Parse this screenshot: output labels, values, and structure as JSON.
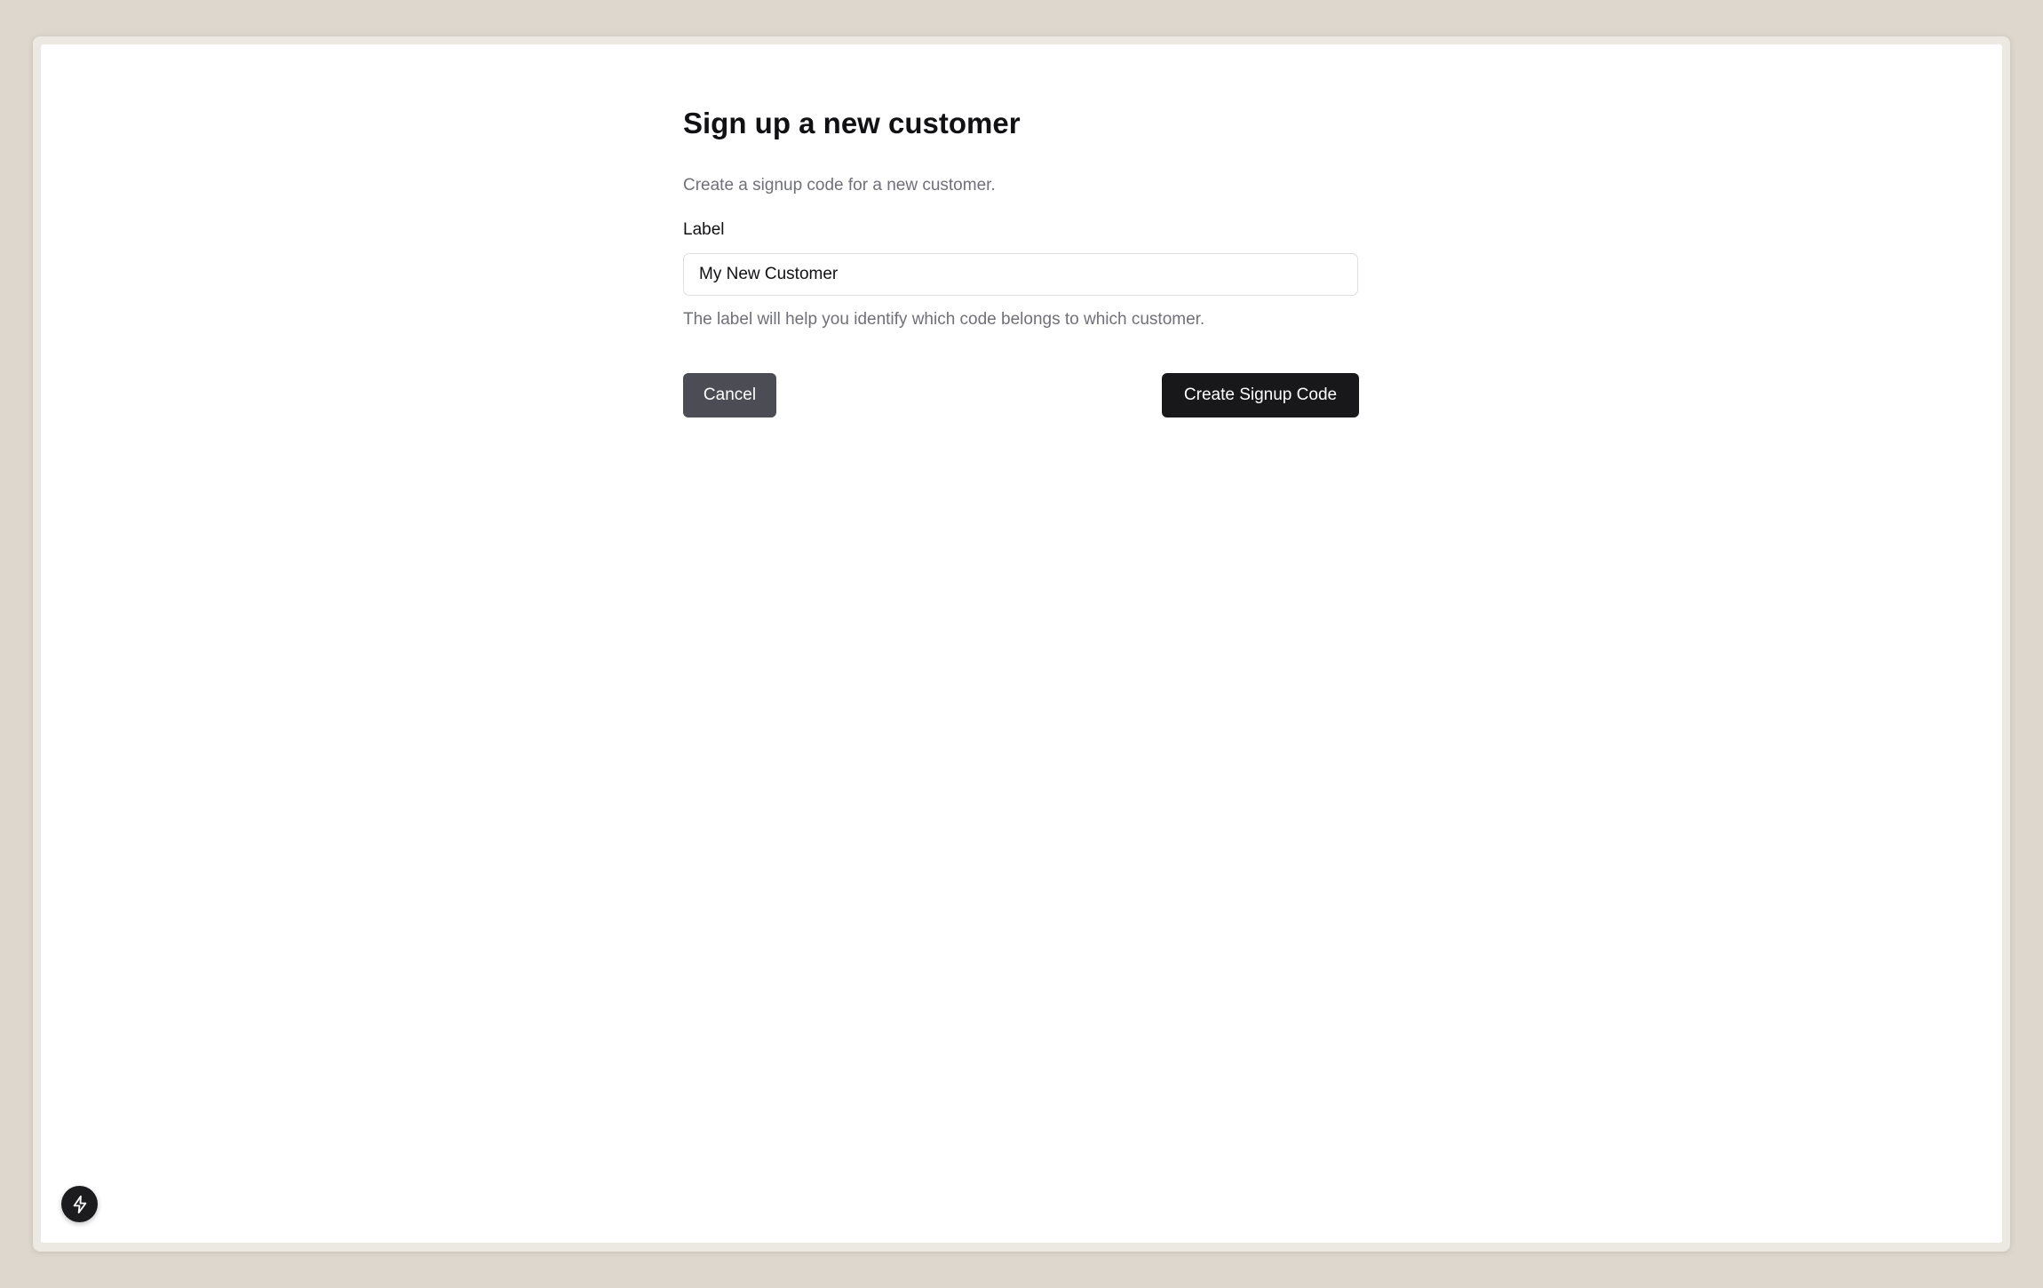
{
  "form": {
    "title": "Sign up a new customer",
    "description": "Create a signup code for a new customer.",
    "label": "Label",
    "input_value": "My New Customer",
    "help_text": "The label will help you identify which code belongs to which customer.",
    "cancel_label": "Cancel",
    "create_label": "Create Signup Code"
  },
  "dev_badge": {
    "icon": "lightning-bolt-icon"
  }
}
